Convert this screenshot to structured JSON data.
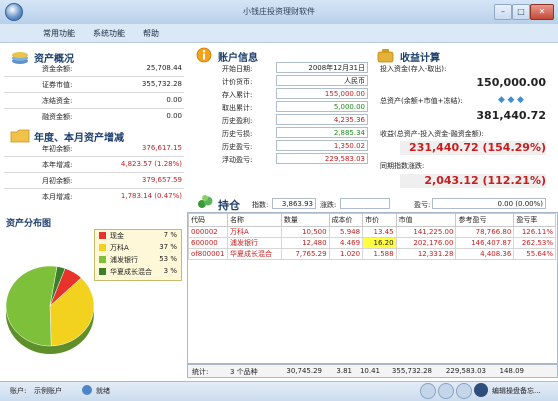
{
  "window": {
    "title": "小钱庄投资理财软件"
  },
  "menu": {
    "items": [
      "常用功能",
      "系统功能",
      "帮助"
    ]
  },
  "asset_overview": {
    "title": "资产概况",
    "rows": [
      {
        "label": "资金余额:",
        "value": "25,708.44",
        "color": "normal"
      },
      {
        "label": "证券市值:",
        "value": "355,732.28",
        "color": "normal"
      },
      {
        "label": "冻结资金:",
        "value": "0.00",
        "color": "normal"
      },
      {
        "label": "融资金额:",
        "value": "0.00",
        "color": "normal"
      }
    ]
  },
  "growth": {
    "title": "年度、本月资产增减",
    "rows": [
      {
        "label": "年初余额:",
        "value": "376,617.15",
        "color": "red"
      },
      {
        "label": "本年增减:",
        "value": "4,823.57 (1.28%)",
        "color": "red"
      },
      {
        "label": "月初余额:",
        "value": "379,657.59",
        "color": "red"
      },
      {
        "label": "本月增减:",
        "value": "1,783.14 (0.47%)",
        "color": "red"
      }
    ]
  },
  "account_info": {
    "title": "账户信息",
    "rows": [
      {
        "label": "开始日期:",
        "value": "2008年12月31日",
        "color": "normal"
      },
      {
        "label": "计价货币:",
        "value": "人民币",
        "color": "normal"
      },
      {
        "label": "存入累计:",
        "value": "155,000.00",
        "color": "red"
      },
      {
        "label": "取出累计:",
        "value": "5,000.00",
        "color": "green"
      },
      {
        "label": "历史盈利:",
        "value": "4,235.36",
        "color": "red"
      },
      {
        "label": "历史亏损:",
        "value": "2,885.34",
        "color": "green"
      },
      {
        "label": "历史盈亏:",
        "value": "1,350.02",
        "color": "red"
      },
      {
        "label": "浮动盈亏:",
        "value": "229,583.03",
        "color": "red"
      }
    ]
  },
  "income": {
    "title": "收益计算",
    "invest_label": "投入资金(存入-取出):",
    "invest_value": "150,000.00",
    "total_label": "总资产(余额+市值+冻结):",
    "total_value": "381,440.72",
    "profit_label": "收益(总资产-投入资金-融资金额):",
    "profit_value": "231,440.72 (154.29%)",
    "index_label": "同期指数涨跌:",
    "index_value": "2,043.12 (112.21%)",
    "diamond_icons": [
      "diamond-icon",
      "diamond-icon",
      "diamond-icon"
    ]
  },
  "holdings": {
    "title": "持仓",
    "index_label": "指数:",
    "index_value": "3,863.93",
    "change_label": "涨跌:",
    "profit_label": "盈亏:",
    "profit_value": "0.00 (0.00%)",
    "columns": [
      "代码",
      "名称",
      "数量",
      "成本价",
      "市价",
      "市值",
      "参考盈亏",
      "盈亏率"
    ],
    "rows": [
      {
        "cells": [
          "000002",
          "万科A",
          "10,500",
          "5.948",
          "13.45",
          "141,225.00",
          "78,766.80",
          "126.11%"
        ]
      },
      {
        "cells": [
          "600000",
          "浦发银行",
          "12,480",
          "4.469",
          "16.20",
          "202,176.00",
          "146,407.87",
          "262.53%"
        ]
      },
      {
        "cells": [
          "of800001",
          "华夏成长混合",
          "7,765.29",
          "1.020",
          "1.588",
          "12,331.28",
          "4,408.36",
          "55.64%"
        ]
      }
    ],
    "summary": [
      "统计:",
      "3 个品种",
      "30,745.29",
      "3.81",
      "10.41",
      "355,732.28",
      "229,583.03",
      "148.09"
    ]
  },
  "distribution": {
    "title": "资产分布图",
    "legend": [
      {
        "name": "现金",
        "pct": "7 %",
        "color": "#e8332b",
        "value": 7
      },
      {
        "name": "万科A",
        "pct": "37 %",
        "color": "#f2d21e",
        "value": 37
      },
      {
        "name": "浦发银行",
        "pct": "53 %",
        "color": "#7ec03a",
        "value": 53
      },
      {
        "name": "华夏成长混合",
        "pct": "3 %",
        "color": "#3a7f2a",
        "value": 3
      }
    ]
  },
  "status": {
    "account_label": "账户:",
    "account_value": "示例账户",
    "state": "就绪",
    "help_text": "编辑操盘备忘..."
  }
}
